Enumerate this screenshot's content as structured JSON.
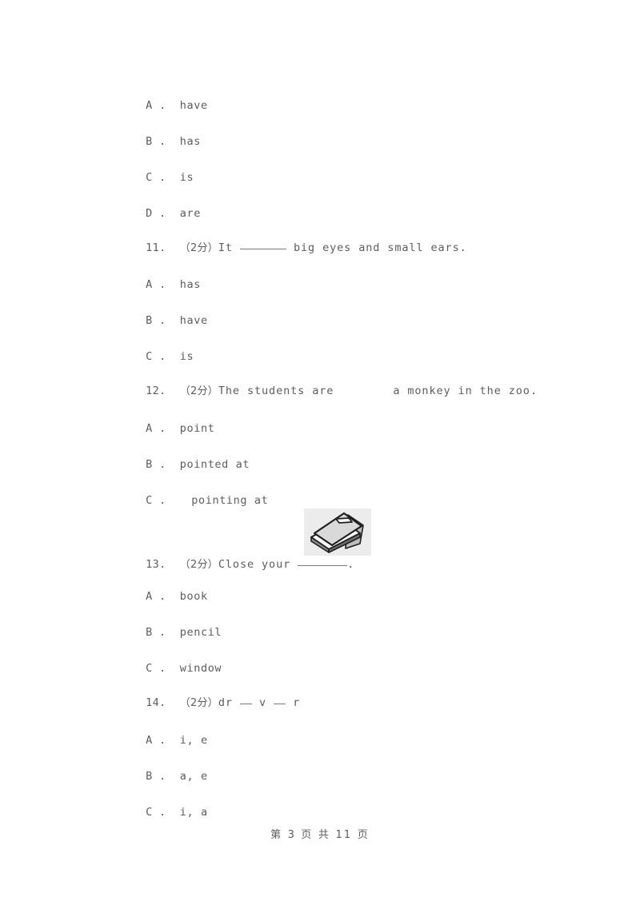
{
  "page": {
    "background": "#ffffff",
    "text_color": "#5d5d5d"
  },
  "leading_options": [
    {
      "letter": "A",
      "sep": " .  ",
      "text": "have"
    },
    {
      "letter": "B",
      "sep": " .  ",
      "text": "has"
    },
    {
      "letter": "C",
      "sep": " .  ",
      "text": "is"
    },
    {
      "letter": "D",
      "sep": " .  ",
      "text": "are"
    }
  ],
  "questions": [
    {
      "number": "11.",
      "score": "（2分）",
      "stem_before": "It ",
      "blank_style": "underline",
      "stem_after": " big eyes and small ears.",
      "options": [
        {
          "letter": "A",
          "sep": " .  ",
          "text": "has"
        },
        {
          "letter": "B",
          "sep": " .  ",
          "text": "have"
        },
        {
          "letter": "C",
          "sep": " .  ",
          "text": "is"
        }
      ]
    },
    {
      "number": "12.",
      "score": "（2分）",
      "stem_before": "The students are",
      "blank_style": "gap",
      "stem_after": "a monkey in the zoo.",
      "options": [
        {
          "letter": "A",
          "sep": " .  ",
          "text": "point"
        },
        {
          "letter": "B",
          "sep": " .  ",
          "text": "pointed at"
        },
        {
          "letter": "C",
          "sep": " .   ",
          "text": "pointing at"
        }
      ]
    },
    {
      "number": "13.",
      "score": "（2分）",
      "stem_before": "Close your ",
      "blank_style": "underline",
      "stem_after": ".",
      "options": [
        {
          "letter": "A",
          "sep": " .  ",
          "text": "book"
        },
        {
          "letter": "B",
          "sep": " .  ",
          "text": "pencil"
        },
        {
          "letter": "C",
          "sep": " .  ",
          "text": "window"
        }
      ]
    },
    {
      "number": "14.",
      "score": "（2分）",
      "stem_before": "dr ",
      "blank_style": "short-pair",
      "stem_mid": " v ",
      "stem_after": " r",
      "options": [
        {
          "letter": "A",
          "sep": " .  ",
          "text": "i, e"
        },
        {
          "letter": "B",
          "sep": " .  ",
          "text": "a, e"
        },
        {
          "letter": "C",
          "sep": " .  ",
          "text": "i, a"
        }
      ]
    }
  ],
  "clipart": {
    "name": "closed-book-illustration",
    "background": "#ececec",
    "cover_color": "#d9d9d9",
    "outline_color": "#1a1a1a"
  },
  "footer": {
    "text": "第 3 页 共 11 页",
    "current_page": "3",
    "total_pages": "11"
  }
}
